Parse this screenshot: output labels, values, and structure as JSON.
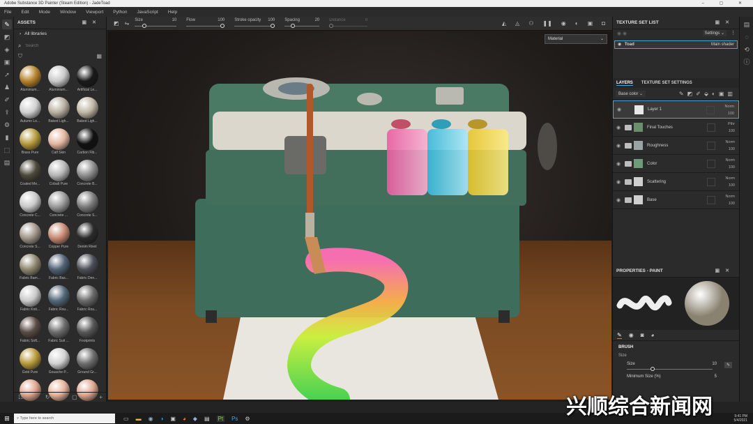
{
  "window": {
    "title": "Adobe Substance 3D Painter (Steam Edition) - JadeToad"
  },
  "menu": [
    "File",
    "Edit",
    "Mode",
    "Window",
    "Viewport",
    "Python",
    "JavaScript",
    "Help"
  ],
  "toolbar": {
    "params": [
      {
        "label": "Size",
        "value": "10",
        "level": 0.2
      },
      {
        "label": "Flow",
        "value": "100",
        "level": 1.0
      },
      {
        "label": "Stroke opacity",
        "value": "100",
        "level": 1.0
      },
      {
        "label": "Spacing",
        "value": "20",
        "level": 0.2
      },
      {
        "label": "Distance",
        "value": "0",
        "level": 0.0
      }
    ]
  },
  "assets": {
    "title": "ASSETS",
    "library": "All libraries",
    "search_placeholder": "Search",
    "materials": [
      {
        "label": "Aluminium...",
        "color": "#b6832b"
      },
      {
        "label": "Aluminium...",
        "color": "#c9c9c9"
      },
      {
        "label": "Artificial Le...",
        "color": "#1a1a1a"
      },
      {
        "label": "Autumn Le...",
        "color": "#d0d0d0"
      },
      {
        "label": "Baked Ligh...",
        "color": "#b7afa0"
      },
      {
        "label": "Baked Ligh...",
        "color": "#bfb6a5"
      },
      {
        "label": "Brass Pure",
        "color": "#b59a3c"
      },
      {
        "label": "Calf Skin",
        "color": "#e3b7a0"
      },
      {
        "label": "Carbon Fib...",
        "color": "#111111"
      },
      {
        "label": "Coated Me...",
        "color": "#4d4a3c"
      },
      {
        "label": "Cobalt Pure",
        "color": "#b7b7b7"
      },
      {
        "label": "Concrete B...",
        "color": "#8f8f8f"
      },
      {
        "label": "Concrete C...",
        "color": "#c9c9c9"
      },
      {
        "label": "Concrete ...",
        "color": "#9b9b9b"
      },
      {
        "label": "Concrete S...",
        "color": "#7d7d7d"
      },
      {
        "label": "Concrete S...",
        "color": "#a1968a"
      },
      {
        "label": "Copper Pure",
        "color": "#c98a74"
      },
      {
        "label": "Denim Rivet",
        "color": "#2b2b2b"
      },
      {
        "label": "Fabric Bam...",
        "color": "#8e8770"
      },
      {
        "label": "Fabric Bas...",
        "color": "#506274"
      },
      {
        "label": "Fabric Den...",
        "color": "#4b4f56"
      },
      {
        "label": "Fabric Knit...",
        "color": "#c9c9c9"
      },
      {
        "label": "Fabric Rou...",
        "color": "#536779"
      },
      {
        "label": "Fabric Rou...",
        "color": "#6a6a6a"
      },
      {
        "label": "Fabric Soft...",
        "color": "#5b4c45"
      },
      {
        "label": "Fabric Suit ...",
        "color": "#6b6b6b"
      },
      {
        "label": "Footprints",
        "color": "#575757"
      },
      {
        "label": "Gold Pure",
        "color": "#b89a3a"
      },
      {
        "label": "Gouache P...",
        "color": "#d2d2d2"
      },
      {
        "label": "Ground Gr...",
        "color": "#6e6e6e"
      },
      {
        "label": "",
        "color": "#e0a58c"
      },
      {
        "label": "",
        "color": "#e8b29a"
      },
      {
        "label": "",
        "color": "#e0a68f"
      }
    ]
  },
  "viewport": {
    "camera_dropdown": "Material"
  },
  "texture_set_list": {
    "title": "TEXTURE SET LIST",
    "settings_label": "Settings",
    "item_name": "Toad",
    "item_shader": "Main shader"
  },
  "layers": {
    "tabs": [
      "LAYERS",
      "TEXTURE SET SETTINGS"
    ],
    "channel_dropdown": "Base color",
    "rows": [
      {
        "name": "Layer 1",
        "blend": "Norm",
        "opacity": "100",
        "type": "paint",
        "thumb": "#e8e8e8",
        "selected": true
      },
      {
        "name": "Final Touches",
        "blend": "Pthr",
        "opacity": "100",
        "type": "folder",
        "thumb": "#6a8f6a",
        "selected": false
      },
      {
        "name": "Roughness",
        "blend": "Norm",
        "opacity": "100",
        "type": "folder",
        "thumb": "#9aa3a3",
        "selected": false
      },
      {
        "name": "Color",
        "blend": "Norm",
        "opacity": "100",
        "type": "folder",
        "thumb": "#6e9c7a",
        "selected": false
      },
      {
        "name": "Scattering",
        "blend": "Norm",
        "opacity": "100",
        "type": "folder",
        "thumb": "#cfcfcf",
        "selected": false
      },
      {
        "name": "Base",
        "blend": "Norm",
        "opacity": "100",
        "type": "folder",
        "thumb": "#cfcfcf",
        "selected": false
      }
    ]
  },
  "properties": {
    "title": "PROPERTIES - PAINT",
    "section": "BRUSH",
    "size_label": "Size",
    "size_param": "Size",
    "size_value": "10",
    "min_size_label": "Minimum Size (%)",
    "min_size_value": "5"
  },
  "taskbar": {
    "search_placeholder": "Type here to search",
    "clock_time": "9:41 PM",
    "clock_date": "5/4/2021"
  },
  "watermark": "兴顺综合新闻网",
  "colors": {
    "accent": "#4aa3df",
    "panel": "#2b2b2b",
    "dark": "#1e1e1e"
  }
}
